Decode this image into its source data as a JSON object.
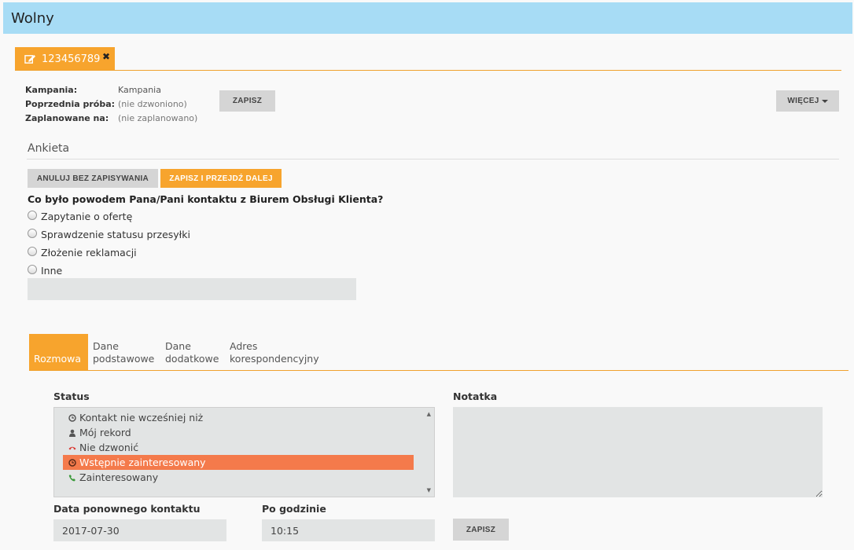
{
  "header": {
    "title": "Wolny"
  },
  "record_tab": {
    "label": "123456789",
    "close_glyph": "✖"
  },
  "meta": {
    "campaign_label": "Kampania:",
    "campaign_value": "Kampania",
    "prev_attempt_label": "Poprzednia próba:",
    "prev_attempt_value": "(nie dzwoniono)",
    "scheduled_label": "Zaplanowane na:",
    "scheduled_value": "(nie zaplanowano)"
  },
  "buttons": {
    "save_top": "ZAPISZ",
    "more": "WIĘCEJ",
    "cancel_no_save": "ANULUJ BEZ ZAPISYWANIA",
    "save_next": "ZAPISZ I PRZEJDŹ DALEJ",
    "save_bottom": "ZAPISZ"
  },
  "survey": {
    "title": "Ankieta",
    "question": "Co było powodem Pana/Pani kontaktu z Biurem Obsługi Klienta?",
    "options": [
      "Zapytanie o ofertę",
      "Sprawdzenie statusu przesyłki",
      "Złożenie reklamacji",
      "Inne"
    ],
    "other_value": ""
  },
  "tabs": [
    {
      "label": "Rozmowa",
      "active": true
    },
    {
      "line1": "Dane",
      "line2": "podstawowe"
    },
    {
      "line1": "Dane",
      "line2": "dodatkowe"
    },
    {
      "line1": "Adres",
      "line2": "korespondencyjny"
    }
  ],
  "conversation": {
    "status_label": "Status",
    "note_label": "Notatka",
    "statuses": [
      {
        "label": "Kontakt nie wcześniej niż",
        "icon": "clock-icon"
      },
      {
        "label": "Mój rekord",
        "icon": "user-icon"
      },
      {
        "label": "Nie dzwonić",
        "icon": "phone-hangup-icon"
      },
      {
        "label": "Wstępnie zainteresowany",
        "icon": "clock-icon",
        "selected": true
      },
      {
        "label": "Zainteresowany",
        "icon": "phone-icon"
      }
    ],
    "note_value": "",
    "recontact_date_label": "Data ponownego kontaktu",
    "recontact_date_value": "2017-07-30",
    "after_hour_label": "Po godzinie",
    "after_hour_value": "10:15"
  },
  "colors": {
    "header_bg": "#a7dcf5",
    "accent": "#f7a42d",
    "selected": "#f47a4b",
    "hangup": "#d9322b",
    "call": "#3a9a3a"
  }
}
